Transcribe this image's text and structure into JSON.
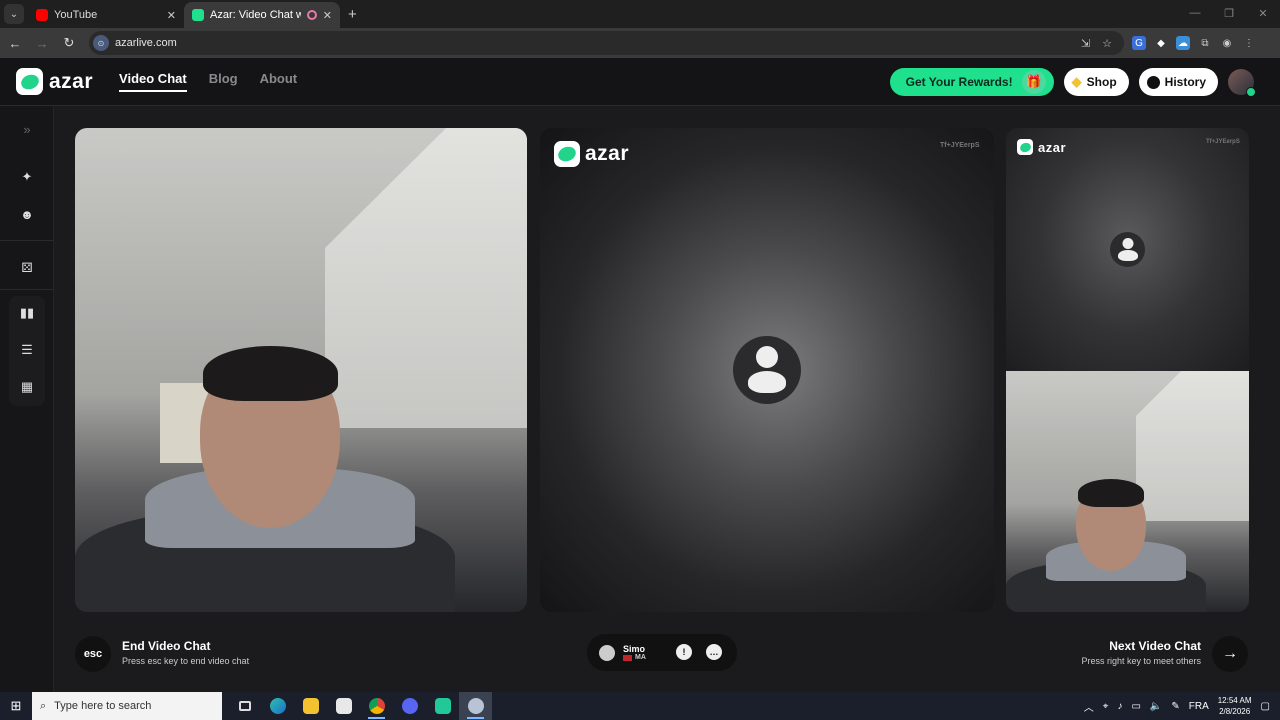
{
  "browser": {
    "tabs": [
      {
        "title": "YouTube",
        "favicon_color": "#ff0000",
        "active": false
      },
      {
        "title": "Azar: Video Chat with New",
        "favicon_color": "#1fe08d",
        "active": true
      }
    ],
    "url": "azarlive.com"
  },
  "site": {
    "logo_text": "azar",
    "nav": [
      {
        "label": "Video Chat",
        "active": true
      },
      {
        "label": "Blog",
        "active": false
      },
      {
        "label": "About",
        "active": false
      }
    ],
    "rewards_label": "Get Your Rewards!",
    "shop_label": "Shop",
    "history_label": "History",
    "accent_color": "#1fe08d"
  },
  "sidebar": {
    "icons": [
      "expand-icon",
      "magic-wand-icon",
      "face-filter-icon",
      "dice-icon",
      "layout-side-by-side-icon",
      "layout-stacked-icon",
      "layout-grid-icon"
    ]
  },
  "remote": {
    "logo_text": "azar",
    "session_id": "Tf+JYEerpS",
    "mini_session_id": "Tf+JYEerpS"
  },
  "controls": {
    "esc_label": "esc",
    "end_title": "End Video Chat",
    "end_sub": "Press esc key to end video chat",
    "user_name": "Simo",
    "user_country": "MA",
    "next_title": "Next Video Chat",
    "next_sub": "Press right key to meet others"
  },
  "taskbar": {
    "search_placeholder": "Type here to search",
    "language": "FRA",
    "time": "12:54 AM",
    "date": "2/8/2026"
  }
}
